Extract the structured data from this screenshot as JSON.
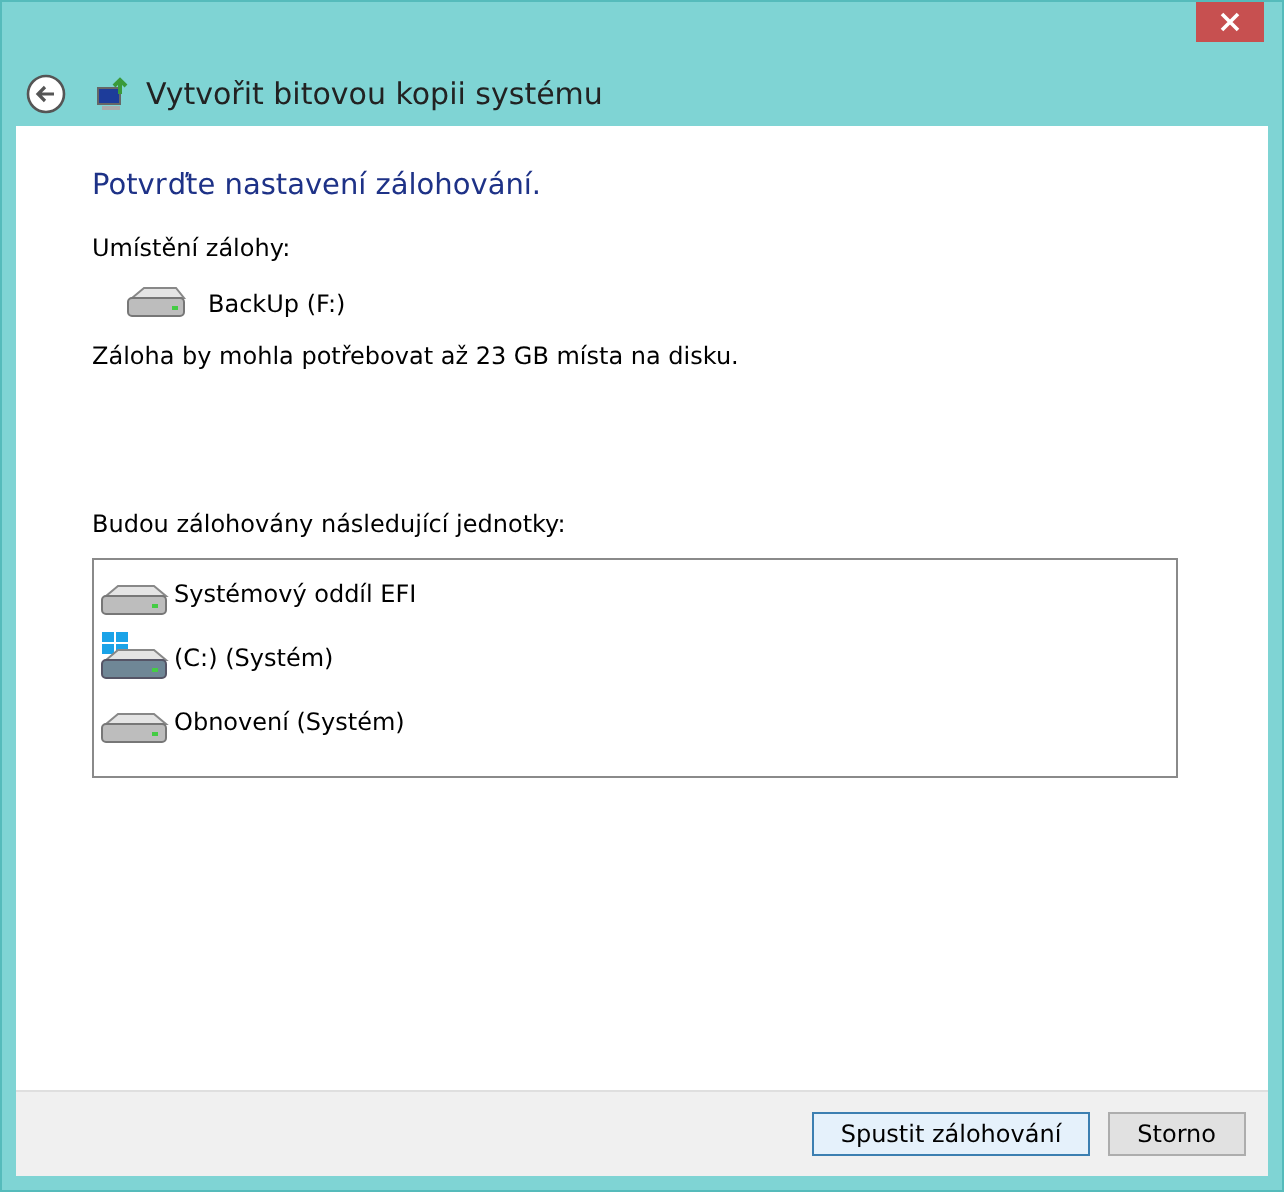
{
  "window": {
    "title": "Vytvořit bitovou kopii systému"
  },
  "heading": "Potvrďte nastavení zálohování.",
  "location_label": "Umístění zálohy:",
  "location": {
    "name": "BackUp (F:)",
    "kind": "drive"
  },
  "space_note": "Záloha by mohla potřebovat až 23 GB místa na disku.",
  "drives_label": "Budou zálohovány následující jednotky:",
  "drives": [
    {
      "name": "Systémový oddíl EFI",
      "kind": "drive"
    },
    {
      "name": "(C:) (Systém)",
      "kind": "system"
    },
    {
      "name": "Obnovení (Systém)",
      "kind": "drive"
    }
  ],
  "buttons": [
    {
      "label": "Spustit zálohování",
      "default": true
    },
    {
      "label": "Storno",
      "default": false
    }
  ]
}
